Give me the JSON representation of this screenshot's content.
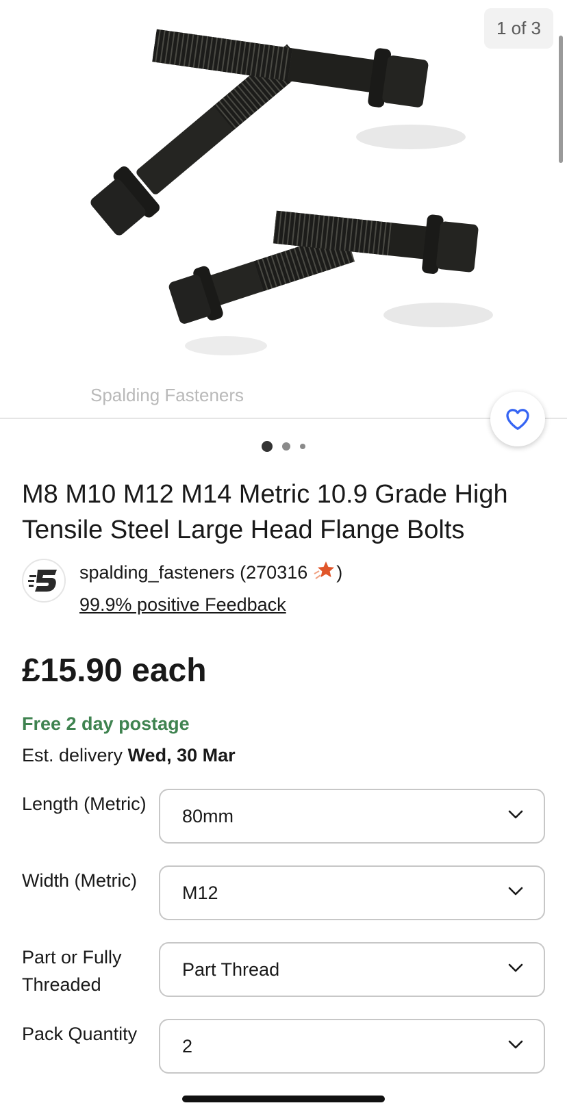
{
  "gallery": {
    "counter": "1 of 3",
    "watermark": "Spalding Fasteners",
    "image_icon": "flange-bolts-photo",
    "watch_icon": "heart-icon",
    "dots": 3,
    "active_dot": 1
  },
  "listing": {
    "title": "M8 M10 M12 M14 Metric 10.9 Grade High Tensile Steel Large Head Flange Bolts"
  },
  "seller": {
    "name": "spalding_fasteners (270316",
    "close_paren": ")",
    "star_icon": "star-icon",
    "feedback": "99.9% positive Feedback"
  },
  "price": {
    "amount": "£15.90 each"
  },
  "shipping": {
    "postage": "Free 2 day postage",
    "delivery_prefix": "Est. delivery ",
    "delivery_date": "Wed, 30 Mar"
  },
  "variations": [
    {
      "label": "Length (Metric)",
      "value": "80mm"
    },
    {
      "label": "Width (Metric)",
      "value": "M12"
    },
    {
      "label": "Part or Fully Threaded",
      "value": "Part Thread"
    },
    {
      "label": "Pack Quantity",
      "value": "2"
    }
  ],
  "colors": {
    "postage_green": "#3f8350",
    "watch_blue": "#3665f3",
    "star_orange": "#e0562a"
  }
}
